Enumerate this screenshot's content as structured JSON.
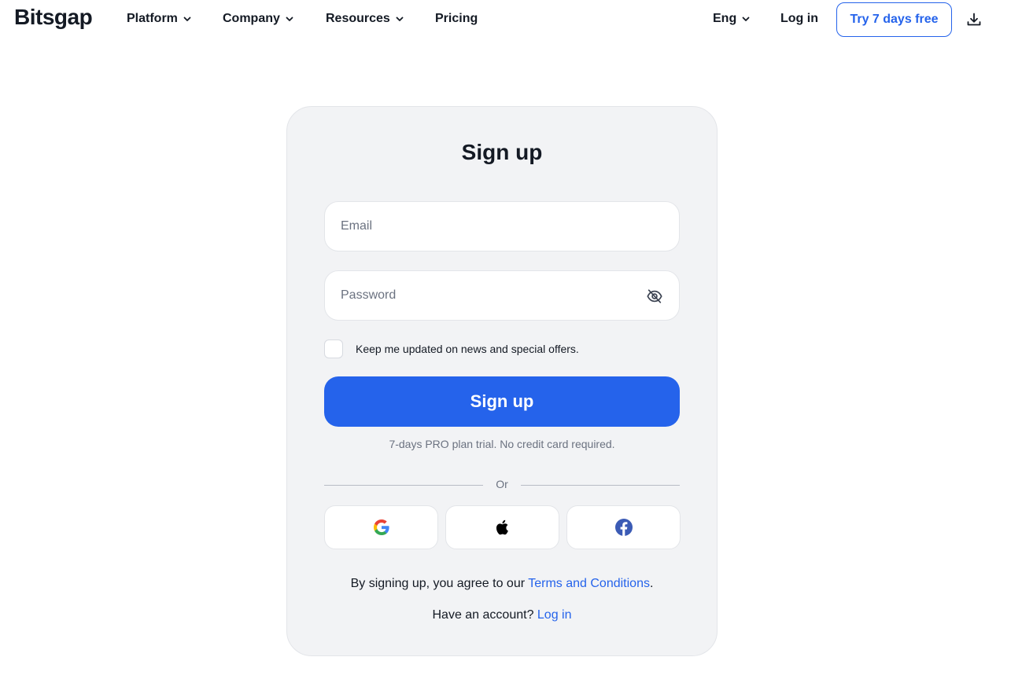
{
  "header": {
    "logo": "Bitsgap",
    "nav": {
      "platform": "Platform",
      "company": "Company",
      "resources": "Resources",
      "pricing": "Pricing"
    },
    "language": "Eng",
    "login": "Log in",
    "try_free": "Try 7 days free"
  },
  "form": {
    "title": "Sign up",
    "email_placeholder": "Email",
    "password_placeholder": "Password",
    "newsletter_label": "Keep me updated on news and special offers.",
    "newsletter_checked": false,
    "submit_label": "Sign up",
    "trial_note": "7-days PRO plan trial. No credit card required.",
    "divider_text": "Or",
    "social": [
      "google-icon",
      "apple-icon",
      "facebook-icon"
    ],
    "terms_prefix": "By signing up, you agree to our ",
    "terms_link": "Terms and Conditions",
    "terms_suffix": ".",
    "account_prefix": "Have an account? ",
    "account_link": "Log in"
  },
  "colors": {
    "accent": "#2563eb",
    "card_bg": "#f2f3f5",
    "text": "#141a24",
    "muted": "#6b7280"
  }
}
